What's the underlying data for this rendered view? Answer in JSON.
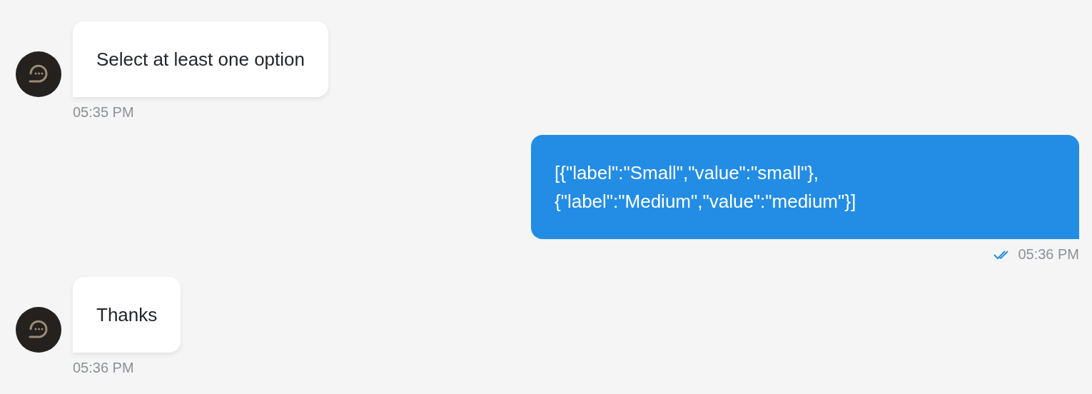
{
  "messages": [
    {
      "kind": "incoming",
      "text": "Select at least one option",
      "time": "05:35 PM"
    },
    {
      "kind": "outgoing",
      "text": "[{\"label\":\"Small\",\"value\":\"small\"}, {\"label\":\"Medium\",\"value\":\"medium\"}]",
      "time": "05:36 PM",
      "read": true
    },
    {
      "kind": "incoming",
      "text": "Thanks",
      "time": "05:36 PM"
    }
  ]
}
